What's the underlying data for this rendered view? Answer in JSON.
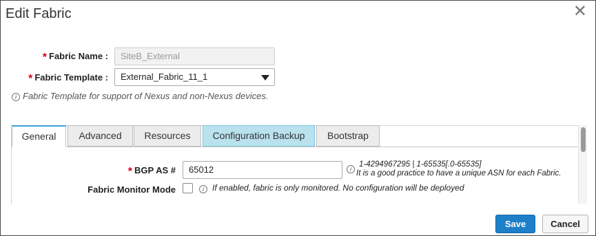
{
  "dialog": {
    "title": "Edit Fabric"
  },
  "form": {
    "fabric_name": {
      "label": "Fabric Name :",
      "value": "SiteB_External"
    },
    "fabric_template": {
      "label": "Fabric Template :",
      "value": "External_Fabric_11_1"
    },
    "template_info": "Fabric Template for support of Nexus and non-Nexus devices."
  },
  "tabs": [
    {
      "label": "General",
      "state": "active"
    },
    {
      "label": "Advanced",
      "state": "normal"
    },
    {
      "label": "Resources",
      "state": "normal"
    },
    {
      "label": "Configuration Backup",
      "state": "highlighted"
    },
    {
      "label": "Bootstrap",
      "state": "normal"
    }
  ],
  "general": {
    "bgp_as": {
      "label": "BGP AS #",
      "value": "65012",
      "hint_line1": "1-4294967295 | 1-65535[.0-65535]",
      "hint_line2": "It is a good practice to have a unique ASN for each Fabric."
    },
    "fabric_monitor_mode": {
      "label": "Fabric Monitor Mode",
      "checked": false,
      "hint": "If enabled, fabric is only monitored. No configuration will be deployed"
    }
  },
  "buttons": {
    "save": "Save",
    "cancel": "Cancel"
  },
  "icons": {
    "close": "close-icon",
    "info": "info-icon",
    "dropdown": "chevron-down-icon"
  },
  "colors": {
    "accent": "#1e7fc9",
    "required": "#d0021b",
    "tab_highlight": "#b9e2ee",
    "tab_active_border": "#35a4d9"
  }
}
